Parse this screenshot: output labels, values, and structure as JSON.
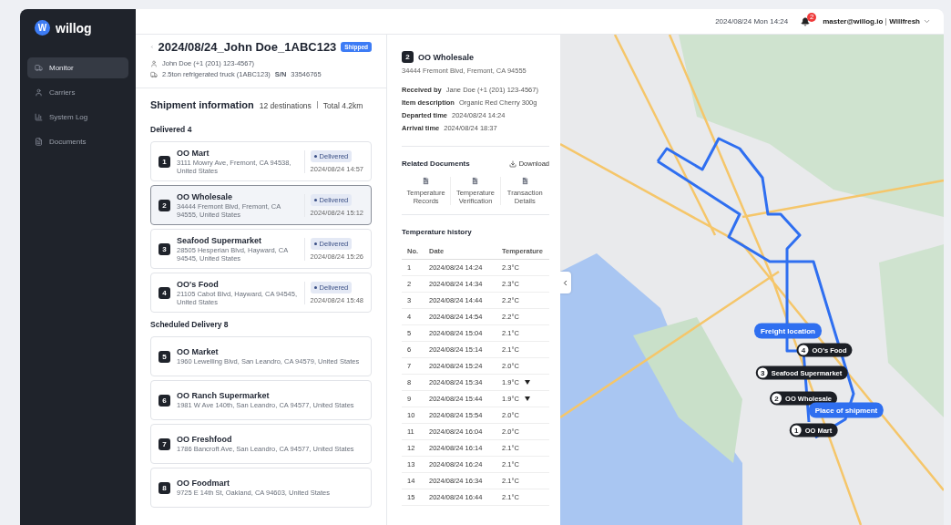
{
  "sidebar": {
    "logo": {
      "mark": "W",
      "name": "willog"
    },
    "items": [
      {
        "label": "Monitor",
        "selected": true
      },
      {
        "label": "Carriers",
        "selected": false
      },
      {
        "label": "System Log",
        "selected": false
      },
      {
        "label": "Documents",
        "selected": false
      }
    ]
  },
  "header": {
    "datetime": "2024/08/24 Mon 14:24",
    "notifications": "2",
    "account": "master@willog.io",
    "company": "Willfresh"
  },
  "shipment": {
    "title": "2024/08/24_John Doe_1ABC123",
    "status": "Shipped",
    "driver": "John Doe (+1 (201) 123-4567)",
    "vehicle": "2.5ton refrigerated truck (1ABC123)",
    "serial_label": "S/N",
    "serial": "33546765",
    "info_title": "Shipment information",
    "destinations": "12 destinations",
    "total": "Total 4.2km",
    "sections": [
      {
        "title": "Delivered 4",
        "stops": [
          {
            "number": "1",
            "name": "OO Mart",
            "address": "3111 Mowry Ave, Fremont, CA 94538, United States",
            "status": "Delivered",
            "time": "2024/08/24 14:57",
            "selected": false
          },
          {
            "number": "2",
            "name": "OO Wholesale",
            "address": "34444 Fremont Blvd, Fremont, CA 94555, United States",
            "status": "Delivered",
            "time": "2024/08/24 15:12",
            "selected": true
          },
          {
            "number": "3",
            "name": "Seafood Supermarket",
            "address": "28505 Hesperian Blvd, Hayward, CA 94545, United States",
            "status": "Delivered",
            "time": "2024/08/24 15:26",
            "selected": false
          },
          {
            "number": "4",
            "name": "OO's Food",
            "address": "21105 Cabot Blvd, Hayward, CA 94545, United States",
            "status": "Delivered",
            "time": "2024/08/24 15:48",
            "selected": false
          }
        ]
      },
      {
        "title": "Scheduled Delivery 8",
        "stops": [
          {
            "number": "5",
            "name": "OO Market",
            "address": "1960 Lewelling Blvd, San Leandro, CA 94579, United States",
            "selected": false
          },
          {
            "number": "6",
            "name": "OO Ranch Supermarket",
            "address": "1981 W Ave 140th, San Leandro, CA 94577, United States",
            "selected": false
          },
          {
            "number": "7",
            "name": "OO Freshfood",
            "address": "1786 Bancroft Ave, San Leandro, CA 94577, United States",
            "selected": false
          },
          {
            "number": "8",
            "name": "OO Foodmart",
            "address": "9725 E 14th St, Oakland, CA 94603, United States",
            "selected": false
          }
        ]
      }
    ]
  },
  "detail": {
    "number": "2",
    "name": "OO Wholesale",
    "address": "34444 Fremont Blvd, Fremont, CA 94555",
    "fields": [
      {
        "label": "Received by",
        "value": "Jane Doe (+1 (201) 123-4567)"
      },
      {
        "label": "Item description",
        "value": "Organic Red Cherry 300g"
      },
      {
        "label": "Departed time",
        "value": "2024/08/24 14:24"
      },
      {
        "label": "Arrival time",
        "value": "2024/08/24 18:37"
      }
    ],
    "documents_title": "Related Documents",
    "download": "Download",
    "documents": [
      "Temperature Records",
      "Temperature Verification",
      "Transaction Details"
    ],
    "history_title": "Temperature history",
    "columns": [
      "No.",
      "Date",
      "Temperature"
    ],
    "rows": [
      {
        "no": "1",
        "date": "2024/08/24 14:24",
        "temp": "2.3°C",
        "alert": false
      },
      {
        "no": "2",
        "date": "2024/08/24 14:34",
        "temp": "2.3°C",
        "alert": false
      },
      {
        "no": "3",
        "date": "2024/08/24 14:44",
        "temp": "2.2°C",
        "alert": false
      },
      {
        "no": "4",
        "date": "2024/08/24 14:54",
        "temp": "2.2°C",
        "alert": false
      },
      {
        "no": "5",
        "date": "2024/08/24 15:04",
        "temp": "2.1°C",
        "alert": false
      },
      {
        "no": "6",
        "date": "2024/08/24 15:14",
        "temp": "2.1°C",
        "alert": false
      },
      {
        "no": "7",
        "date": "2024/08/24 15:24",
        "temp": "2.0°C",
        "alert": false
      },
      {
        "no": "8",
        "date": "2024/08/24 15:34",
        "temp": "1.9°C",
        "alert": true
      },
      {
        "no": "9",
        "date": "2024/08/24 15:44",
        "temp": "1.9°C",
        "alert": true
      },
      {
        "no": "10",
        "date": "2024/08/24 15:54",
        "temp": "2.0°C",
        "alert": false
      },
      {
        "no": "11",
        "date": "2024/08/24 16:04",
        "temp": "2.0°C",
        "alert": false
      },
      {
        "no": "12",
        "date": "2024/08/24 16:14",
        "temp": "2.1°C",
        "alert": false
      },
      {
        "no": "13",
        "date": "2024/08/24 16:24",
        "temp": "2.1°C",
        "alert": false
      },
      {
        "no": "14",
        "date": "2024/08/24 16:34",
        "temp": "2.1°C",
        "alert": false
      },
      {
        "no": "15",
        "date": "2024/08/24 16:44",
        "temp": "2.1°C",
        "alert": false
      }
    ]
  },
  "map": {
    "markers": [
      {
        "kind": "label",
        "text": "Freight location"
      },
      {
        "kind": "stop",
        "number": "4",
        "text": "OO's Food"
      },
      {
        "kind": "stop",
        "number": "3",
        "text": "Seafood Supermarket"
      },
      {
        "kind": "stop",
        "number": "2",
        "text": "OO Wholesale"
      },
      {
        "kind": "label",
        "text": "Place of shipment"
      },
      {
        "kind": "stop",
        "number": "1",
        "text": "OO Mart"
      }
    ]
  }
}
